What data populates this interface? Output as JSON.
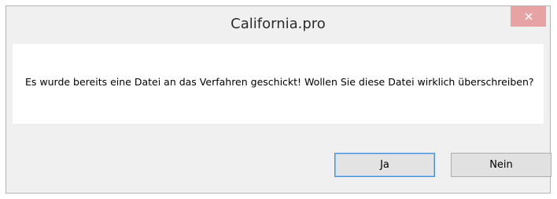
{
  "dialog": {
    "title": "California.pro",
    "close_icon": "close-icon",
    "message": "Es wurde bereits eine Datei an das Verfahren geschickt! Wollen Sie diese Datei wirklich überschreiben?",
    "yes_label": "Ja",
    "no_label": "Nein"
  },
  "colors": {
    "close_button": "#e7a3a4",
    "focus_border": "#4a90d9"
  }
}
